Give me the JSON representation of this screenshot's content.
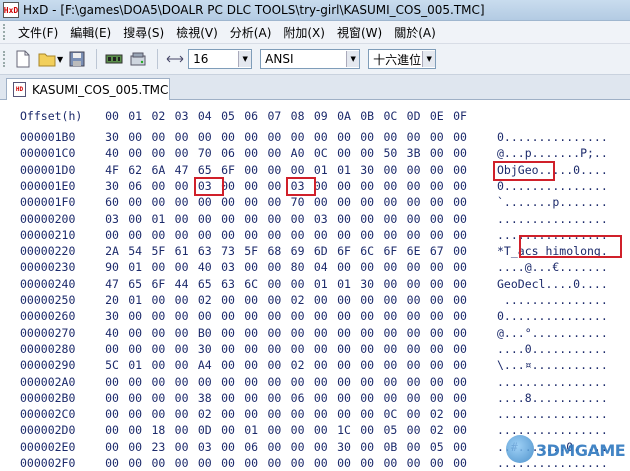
{
  "window": {
    "app_icon_label": "HxD",
    "title": "HxD - [F:\\games\\DOA5\\DOALR PC DLC TOOLS\\try-girl\\KASUMI_COS_005.TMC]"
  },
  "menu": [
    "文件(F)",
    "編輯(E)",
    "搜尋(S)",
    "檢視(V)",
    "分析(A)",
    "附加(X)",
    "視窗(W)",
    "關於(A)"
  ],
  "toolbar": {
    "bytes_per_row": "16",
    "charset": "ANSI",
    "offset_base": "十六進位"
  },
  "tab": {
    "label": "KASUMI_COS_005.TMC"
  },
  "hex": {
    "header_offset": "Offset(h)",
    "header_cols": [
      "00",
      "01",
      "02",
      "03",
      "04",
      "05",
      "06",
      "07",
      "08",
      "09",
      "0A",
      "0B",
      "0C",
      "0D",
      "0E",
      "0F"
    ],
    "rows": [
      {
        "offset": "000001B0",
        "bytes": [
          "30",
          "00",
          "00",
          "00",
          "00",
          "00",
          "00",
          "00",
          "00",
          "00",
          "00",
          "00",
          "00",
          "00",
          "00",
          "00"
        ],
        "ascii": "0..............."
      },
      {
        "offset": "000001C0",
        "bytes": [
          "40",
          "00",
          "00",
          "00",
          "70",
          "06",
          "00",
          "00",
          "A0",
          "0C",
          "00",
          "00",
          "50",
          "3B",
          "00",
          "00"
        ],
        "ascii": "@...p.......P;.."
      },
      {
        "offset": "000001D0",
        "bytes": [
          "4F",
          "62",
          "6A",
          "47",
          "65",
          "6F",
          "00",
          "00",
          "00",
          "01",
          "01",
          "30",
          "00",
          "00",
          "00",
          "00"
        ],
        "ascii": "ObjGeo.....0...."
      },
      {
        "offset": "000001E0",
        "bytes": [
          "30",
          "06",
          "00",
          "00",
          "03",
          "00",
          "00",
          "00",
          "03",
          "00",
          "00",
          "00",
          "00",
          "00",
          "00",
          "00"
        ],
        "ascii": "0..............."
      },
      {
        "offset": "000001F0",
        "bytes": [
          "60",
          "00",
          "00",
          "00",
          "00",
          "00",
          "00",
          "00",
          "70",
          "00",
          "00",
          "00",
          "00",
          "00",
          "00",
          "00"
        ],
        "ascii": "`.......p......."
      },
      {
        "offset": "00000200",
        "bytes": [
          "03",
          "00",
          "01",
          "00",
          "00",
          "00",
          "00",
          "00",
          "00",
          "03",
          "00",
          "00",
          "00",
          "00",
          "00",
          "00"
        ],
        "ascii": "................"
      },
      {
        "offset": "00000210",
        "bytes": [
          "00",
          "00",
          "00",
          "00",
          "00",
          "00",
          "00",
          "00",
          "00",
          "00",
          "00",
          "00",
          "00",
          "00",
          "00",
          "00"
        ],
        "ascii": "................"
      },
      {
        "offset": "00000220",
        "bytes": [
          "2A",
          "54",
          "5F",
          "61",
          "63",
          "73",
          "5F",
          "68",
          "69",
          "6D",
          "6F",
          "6C",
          "6F",
          "6E",
          "67",
          "00"
        ],
        "ascii": "*T_acs_himolong."
      },
      {
        "offset": "00000230",
        "bytes": [
          "90",
          "01",
          "00",
          "00",
          "40",
          "03",
          "00",
          "00",
          "80",
          "04",
          "00",
          "00",
          "00",
          "00",
          "00",
          "00"
        ],
        "ascii": "....@...€......."
      },
      {
        "offset": "00000240",
        "bytes": [
          "47",
          "65",
          "6F",
          "44",
          "65",
          "63",
          "6C",
          "00",
          "00",
          "01",
          "01",
          "30",
          "00",
          "00",
          "00",
          "00"
        ],
        "ascii": "GeoDecl....0...."
      },
      {
        "offset": "00000250",
        "bytes": [
          "20",
          "01",
          "00",
          "00",
          "02",
          "00",
          "00",
          "00",
          "02",
          "00",
          "00",
          "00",
          "00",
          "00",
          "00",
          "00"
        ],
        "ascii": " ..............."
      },
      {
        "offset": "00000260",
        "bytes": [
          "30",
          "00",
          "00",
          "00",
          "00",
          "00",
          "00",
          "00",
          "00",
          "00",
          "00",
          "00",
          "00",
          "00",
          "00",
          "00"
        ],
        "ascii": "0..............."
      },
      {
        "offset": "00000270",
        "bytes": [
          "40",
          "00",
          "00",
          "00",
          "B0",
          "00",
          "00",
          "00",
          "00",
          "00",
          "00",
          "00",
          "00",
          "00",
          "00",
          "00"
        ],
        "ascii": "@...°..........."
      },
      {
        "offset": "00000280",
        "bytes": [
          "00",
          "00",
          "00",
          "00",
          "30",
          "00",
          "00",
          "00",
          "00",
          "00",
          "00",
          "00",
          "00",
          "00",
          "00",
          "00"
        ],
        "ascii": "....0..........."
      },
      {
        "offset": "00000290",
        "bytes": [
          "5C",
          "01",
          "00",
          "00",
          "A4",
          "00",
          "00",
          "00",
          "02",
          "00",
          "00",
          "00",
          "00",
          "00",
          "00",
          "00"
        ],
        "ascii": "\\...¤..........."
      },
      {
        "offset": "000002A0",
        "bytes": [
          "00",
          "00",
          "00",
          "00",
          "00",
          "00",
          "00",
          "00",
          "00",
          "00",
          "00",
          "00",
          "00",
          "00",
          "00",
          "00"
        ],
        "ascii": "................"
      },
      {
        "offset": "000002B0",
        "bytes": [
          "00",
          "00",
          "00",
          "00",
          "38",
          "00",
          "00",
          "00",
          "06",
          "00",
          "00",
          "00",
          "00",
          "00",
          "00",
          "00"
        ],
        "ascii": "....8..........."
      },
      {
        "offset": "000002C0",
        "bytes": [
          "00",
          "00",
          "00",
          "00",
          "02",
          "00",
          "00",
          "00",
          "00",
          "00",
          "00",
          "00",
          "0C",
          "00",
          "02",
          "00"
        ],
        "ascii": "................"
      },
      {
        "offset": "000002D0",
        "bytes": [
          "00",
          "00",
          "18",
          "00",
          "0D",
          "00",
          "01",
          "00",
          "00",
          "00",
          "1C",
          "00",
          "05",
          "00",
          "02",
          "00"
        ],
        "ascii": "................"
      },
      {
        "offset": "000002E0",
        "bytes": [
          "00",
          "00",
          "23",
          "00",
          "03",
          "00",
          "06",
          "00",
          "00",
          "00",
          "30",
          "00",
          "0B",
          "00",
          "05",
          "00"
        ],
        "ascii": "..#.......0....."
      },
      {
        "offset": "000002F0",
        "bytes": [
          "00",
          "00",
          "00",
          "00",
          "00",
          "00",
          "00",
          "00",
          "00",
          "00",
          "00",
          "00",
          "00",
          "00",
          "00",
          "00"
        ],
        "ascii": "................"
      }
    ]
  },
  "watermark": {
    "text": "3DMGAME"
  },
  "colors": {
    "highlight": "#d0202a",
    "hex_text": "#1c2a6b",
    "title_bar": "#c9dcee"
  }
}
